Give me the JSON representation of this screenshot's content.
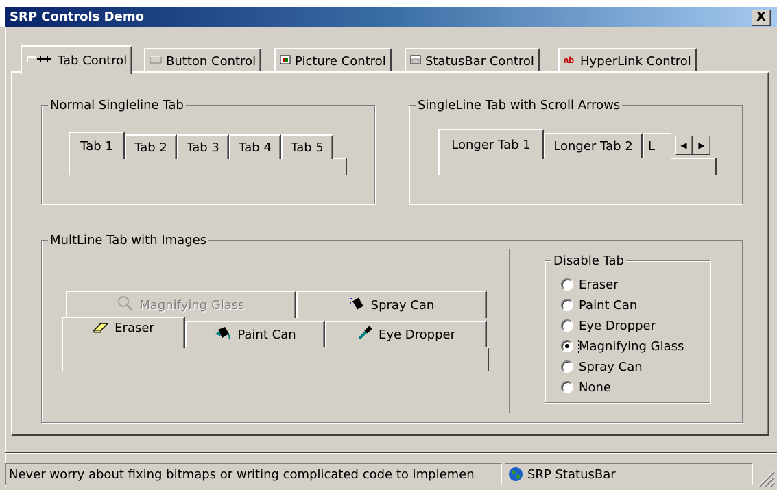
{
  "window": {
    "title": "SRP Controls Demo",
    "close_label": "X"
  },
  "main_tabs": [
    {
      "label": "Tab Control",
      "icon": "tab-icon"
    },
    {
      "label": "Button Control",
      "icon": "button-icon"
    },
    {
      "label": "Picture Control",
      "icon": "picture-icon"
    },
    {
      "label": "StatusBar Control",
      "icon": "statusbar-icon"
    },
    {
      "label": "HyperLink Control",
      "icon": "hyperlink-icon"
    }
  ],
  "normal_group": {
    "label": "Normal Singleline Tab",
    "tabs": [
      "Tab 1",
      "Tab 2",
      "Tab 3",
      "Tab 4",
      "Tab 5"
    ]
  },
  "scroll_group": {
    "label": "SingleLine Tab with Scroll Arrows",
    "tabs": [
      "Longer Tab 1",
      "Longer Tab 2",
      "L"
    ]
  },
  "multiline_group": {
    "label": "MultLine Tab with Images",
    "row_back": [
      {
        "label": "Magnifying Glass",
        "icon": "magnifying-glass-icon",
        "disabled": true
      },
      {
        "label": "Spray Can",
        "icon": "spray-can-icon"
      }
    ],
    "row_front": [
      {
        "label": "Eraser",
        "icon": "eraser-icon"
      },
      {
        "label": "Paint Can",
        "icon": "paint-can-icon"
      },
      {
        "label": "Eye Dropper",
        "icon": "eye-dropper-icon"
      }
    ]
  },
  "disable_group": {
    "label": "Disable Tab",
    "options": [
      "Eraser",
      "Paint Can",
      "Eye Dropper",
      "Magnifying Glass",
      "Spray Can",
      "None"
    ],
    "selected": "Magnifying Glass"
  },
  "statusbar": {
    "message": "Never worry about fixing bitmaps or writing complicated code to implemen",
    "app_label": "SRP StatusBar",
    "app_icon": "globe-icon"
  },
  "colors": {
    "title_start": "#0a246a",
    "title_end": "#a6caf0",
    "face": "#d4d0c8"
  }
}
